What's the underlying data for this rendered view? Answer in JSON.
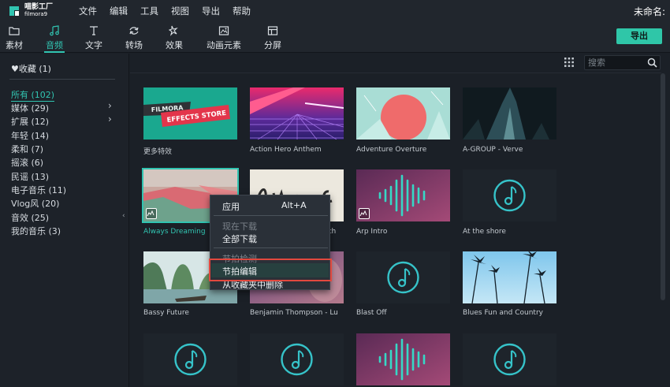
{
  "app": {
    "logo_cn": "喵影工厂",
    "logo_en": "filmora9",
    "project_name": "未命名:",
    "menu": [
      "文件",
      "编辑",
      "工具",
      "视图",
      "导出",
      "帮助"
    ]
  },
  "toolbar": {
    "tabs": [
      {
        "label": "素材",
        "icon": "folder-icon"
      },
      {
        "label": "音频",
        "icon": "music-note-icon"
      },
      {
        "label": "文字",
        "icon": "text-icon"
      },
      {
        "label": "转场",
        "icon": "transition-icon"
      },
      {
        "label": "效果",
        "icon": "effects-icon"
      },
      {
        "label": "动画元素",
        "icon": "image-icon"
      },
      {
        "label": "分屏",
        "icon": "split-screen-icon"
      }
    ],
    "active_tab": "音频",
    "export_label": "导出"
  },
  "sidebar": {
    "favorites": "♥收藏 (1)",
    "categories": [
      {
        "label": "所有 (102)",
        "active": true
      },
      {
        "label": "媒体 (29)",
        "has_children": true
      },
      {
        "label": "扩展 (12)",
        "has_children": true
      },
      {
        "label": "年轻 (14)"
      },
      {
        "label": "柔和 (7)"
      },
      {
        "label": "摇滚 (6)"
      },
      {
        "label": "民谣 (13)"
      },
      {
        "label": "电子音乐 (11)"
      },
      {
        "label": "Vlog风 (20)"
      },
      {
        "label": "音效 (25)"
      },
      {
        "label": "我的音乐 (3)"
      }
    ]
  },
  "search": {
    "placeholder": "搜索"
  },
  "tiles": [
    {
      "label": "更多特效",
      "thumb": "filmora-effects-store",
      "thumb_text": [
        "FILMORA",
        "EFFECTS STORE"
      ]
    },
    {
      "label": "Action Hero Anthem",
      "thumb": "neon-grid"
    },
    {
      "label": "Adventure Overture",
      "thumb": "sun-circle"
    },
    {
      "label": "A-GROUP - Verve",
      "thumb": "dark-crystals"
    },
    {
      "label": "Always Dreaming",
      "thumb": "pink-landscape",
      "selected": true,
      "badge": "waveform-badge-icon"
    },
    {
      "label": "",
      "thumb": "whip-brush"
    },
    {
      "label": "Arp Intro",
      "thumb": "waveform-purple",
      "badge": "waveform-badge-icon"
    },
    {
      "label": "At the shore",
      "thumb": "music-placeholder"
    },
    {
      "label": "Bassy Future",
      "thumb": "karst-river"
    },
    {
      "label": "Benjamin Thompson - Lu",
      "thumb": "violet-portrait"
    },
    {
      "label": "Blast Off",
      "thumb": "music-placeholder"
    },
    {
      "label": "Blues Fun and Country",
      "thumb": "palm-trees"
    },
    {
      "label": "",
      "thumb": "music-placeholder"
    },
    {
      "label": "",
      "thumb": "music-placeholder"
    },
    {
      "label": "",
      "thumb": "waveform-purple"
    },
    {
      "label": "",
      "thumb": "music-placeholder"
    }
  ],
  "partial_label": "th",
  "context_menu": {
    "items": [
      {
        "label": "应用",
        "shortcut": "Alt+A",
        "enabled": true
      },
      {
        "label": "现在下载",
        "enabled": false
      },
      {
        "label": "全部下载",
        "enabled": true
      },
      {
        "label": "节拍检测",
        "enabled": false
      },
      {
        "label": "节拍编辑",
        "enabled": true,
        "highlighted": true
      },
      {
        "label": "从收藏夹中删除",
        "enabled": true
      }
    ]
  },
  "colors": {
    "accent": "#31c4b1",
    "export_button": "#2fc6a8",
    "highlight_box": "#e2483e"
  }
}
